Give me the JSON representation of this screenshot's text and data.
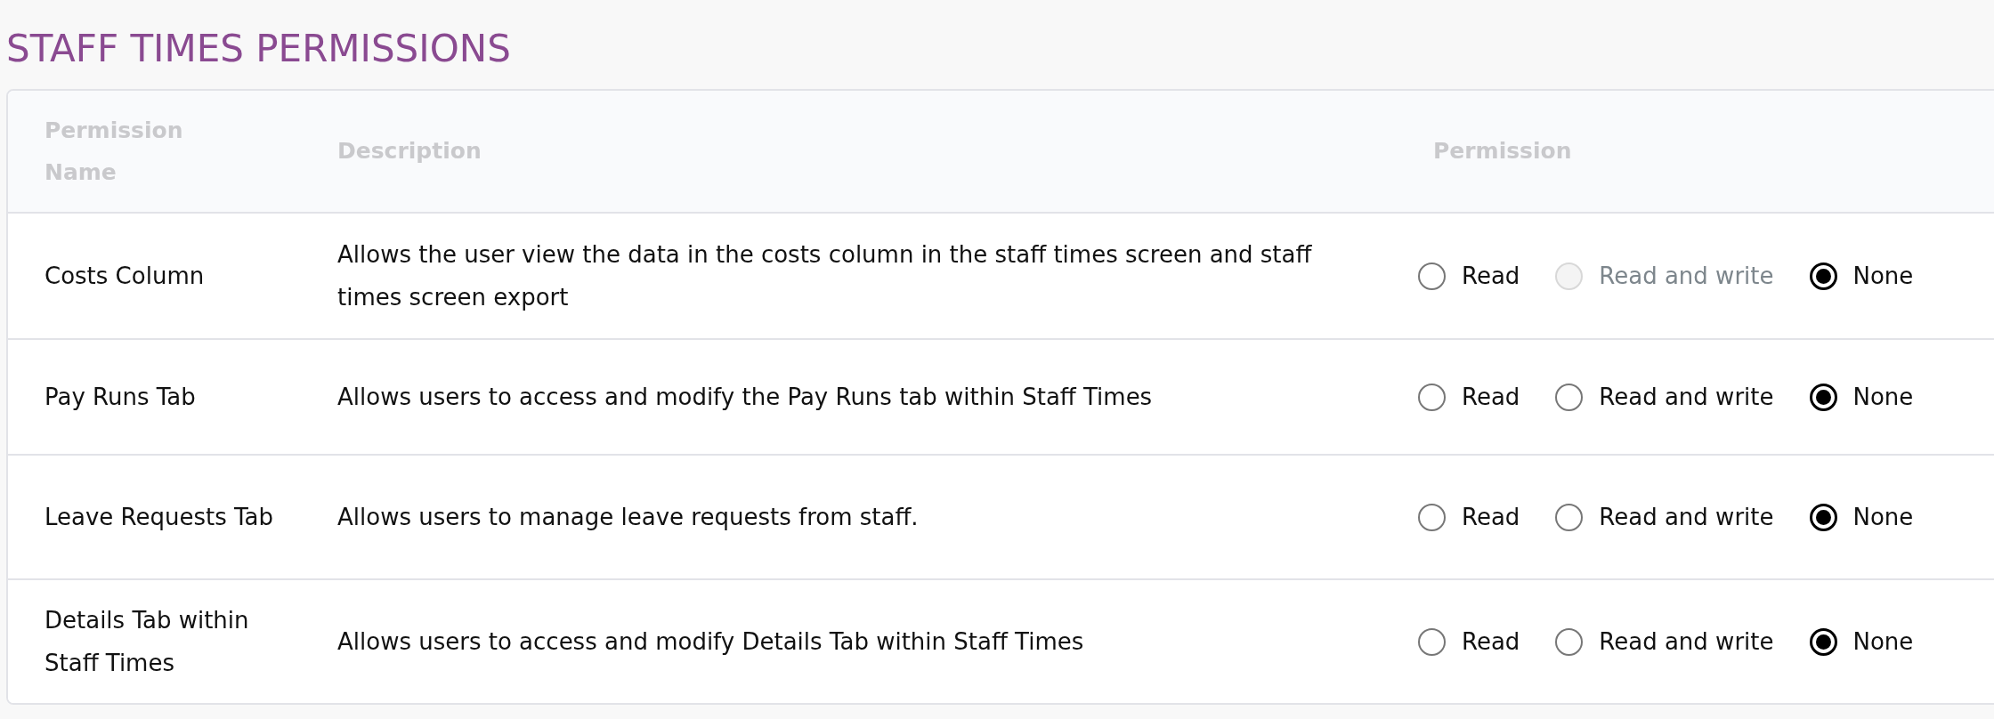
{
  "title": "STAFF TIMES PERMISSIONS",
  "table": {
    "columns": [
      "Permission Name",
      "Description",
      "Permission"
    ],
    "rows": [
      {
        "name": "Costs Column",
        "description": "Allows the user view the data in the costs column in the staff times screen and staff times screen export",
        "options": [
          {
            "label": "Read",
            "selected": false,
            "disabled": false
          },
          {
            "label": "Read and write",
            "selected": false,
            "disabled": true
          },
          {
            "label": "None",
            "selected": true,
            "disabled": false
          }
        ]
      },
      {
        "name": "Pay Runs Tab",
        "description": "Allows users to access and modify the Pay Runs tab within Staff Times",
        "options": [
          {
            "label": "Read",
            "selected": false,
            "disabled": false
          },
          {
            "label": "Read and write",
            "selected": false,
            "disabled": false
          },
          {
            "label": "None",
            "selected": true,
            "disabled": false
          }
        ]
      },
      {
        "name": "Leave Requests Tab",
        "description": "Allows users to manage leave requests from staff.",
        "options": [
          {
            "label": "Read",
            "selected": false,
            "disabled": false
          },
          {
            "label": "Read and write",
            "selected": false,
            "disabled": false
          },
          {
            "label": "None",
            "selected": true,
            "disabled": false
          }
        ]
      },
      {
        "name": "Details Tab within Staff Times",
        "description": "Allows users to access and modify Details Tab within Staff Times",
        "options": [
          {
            "label": "Read",
            "selected": false,
            "disabled": false
          },
          {
            "label": "Read and write",
            "selected": false,
            "disabled": false
          },
          {
            "label": "None",
            "selected": true,
            "disabled": false
          }
        ]
      }
    ]
  }
}
